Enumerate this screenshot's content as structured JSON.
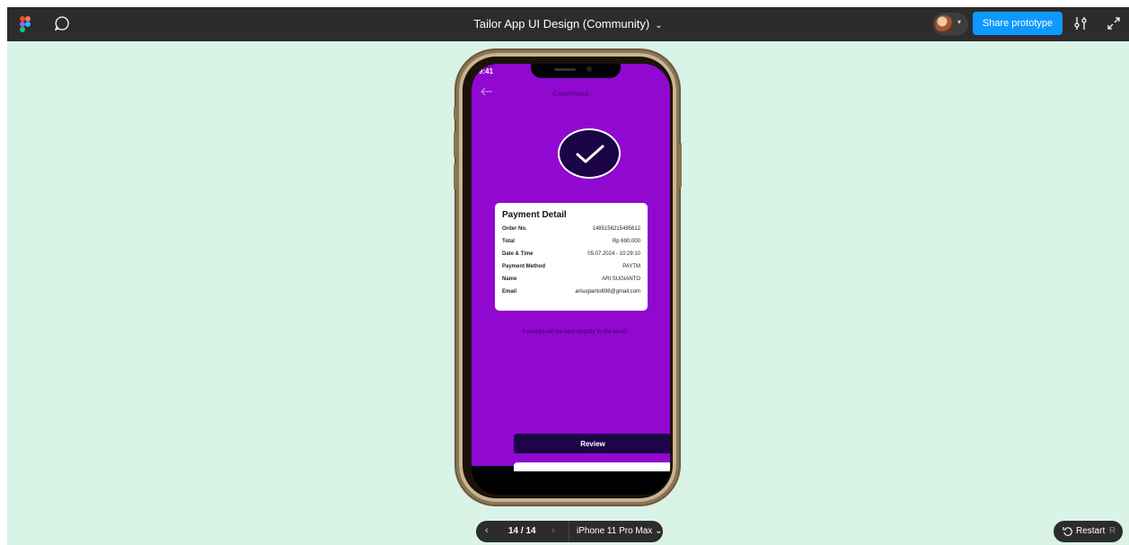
{
  "topbar": {
    "file_title": "Tailor App UI Design (Community)",
    "share_label": "Share prototype"
  },
  "phone_screen": {
    "status_time": "9:41",
    "title": "Confirmed",
    "payment_card": {
      "title": "Payment Detail",
      "rows": [
        {
          "label": "Order No.",
          "value": "1485156215495612"
        },
        {
          "label": "Total",
          "value": "Rp 690.000"
        },
        {
          "label": "Date & Time",
          "value": "05.07.2024 - 10:29:10"
        },
        {
          "label": "Payment Method",
          "value": "PAYTM"
        },
        {
          "label": "Name",
          "value": "ARI SUGIANTO"
        },
        {
          "label": "Email",
          "value": "arisugianto698@gmail.com"
        }
      ]
    },
    "receipt_note": "A receipt will be sent directly to the email",
    "review_label": "Review"
  },
  "navigation": {
    "page_count": "14 / 14",
    "device": "iPhone 11 Pro Max"
  },
  "restart": {
    "label": "Restart",
    "shortcut": "R"
  },
  "colors": {
    "canvas": "#daf3e7",
    "toolbar": "#2c2c2c",
    "accent": "#0d99ff",
    "app_background": "#9108d1",
    "dark_purple": "#1e0548"
  },
  "icons": [
    "figma-logo-icon",
    "comment-icon",
    "chevron-down-icon",
    "settings-icon",
    "expand-icon",
    "arrow-left-icon",
    "check-icon",
    "restart-icon"
  ]
}
